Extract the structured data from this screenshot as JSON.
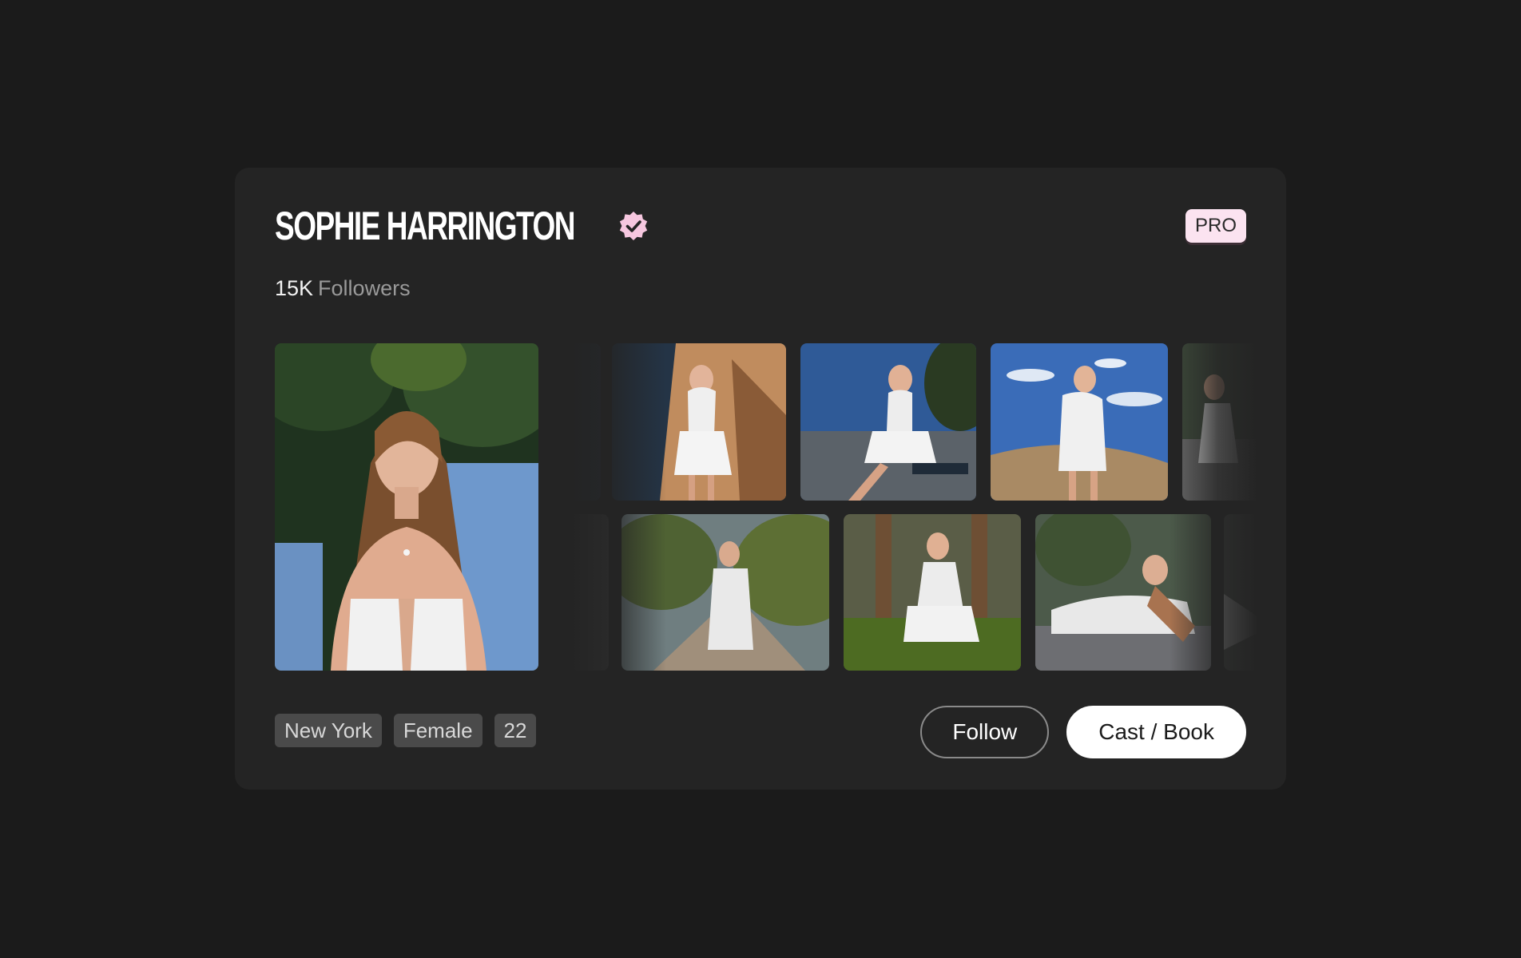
{
  "profile": {
    "name": "SOPHIE HARRINGTON",
    "verified_icon": "verified-badge-icon",
    "badge": "PRO",
    "followers_count": "15K",
    "followers_label": "Followers"
  },
  "gallery": {
    "main_photo": "portrait-photo",
    "photos": [
      "photo-1",
      "photo-2",
      "photo-3",
      "photo-4",
      "photo-5",
      "photo-6",
      "photo-7",
      "photo-8",
      "photo-9",
      "photo-10"
    ]
  },
  "tags": [
    "New York",
    "Female",
    "22"
  ],
  "actions": {
    "follow_label": "Follow",
    "book_label": "Cast / Book"
  },
  "colors": {
    "background": "#1b1b1b",
    "card": "#242424",
    "badge_bg": "#fbe3f0",
    "verified": "#f6c7df",
    "tag_bg": "#4a4a4a"
  }
}
